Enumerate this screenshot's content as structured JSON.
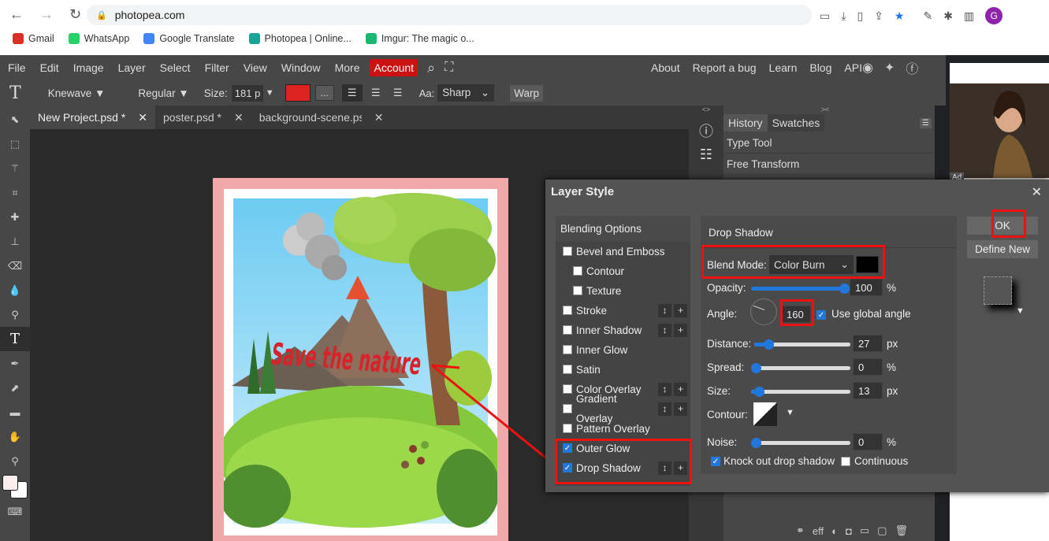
{
  "browser": {
    "url": "photopea.com",
    "profile_initial": "G",
    "bookmarks": [
      {
        "label": "Gmail",
        "color": "#d93025"
      },
      {
        "label": "WhatsApp",
        "color": "#25d366"
      },
      {
        "label": "Google Translate",
        "color": "#4285f4"
      },
      {
        "label": "Photopea | Online...",
        "color": "#18a497"
      },
      {
        "label": "Imgur: The magic o...",
        "color": "#1bb76e"
      }
    ]
  },
  "menu": {
    "items": [
      "File",
      "Edit",
      "Image",
      "Layer",
      "Select",
      "Filter",
      "View",
      "Window",
      "More"
    ],
    "account": "Account",
    "right": [
      "About",
      "Report a bug",
      "Learn",
      "Blog",
      "API"
    ]
  },
  "options": {
    "font": "Knewave",
    "style": "Regular",
    "size_label": "Size:",
    "size": "181 p",
    "more": "...",
    "aa_label": "Aa:",
    "aa": "Sharp",
    "warp": "Warp"
  },
  "tabs": [
    {
      "label": "New Project.psd *"
    },
    {
      "label": "poster.psd *"
    },
    {
      "label": "background-scene.ps"
    }
  ],
  "poster": {
    "text": "Save the nature"
  },
  "history": {
    "tabs": [
      "History",
      "Swatches"
    ],
    "items": [
      "Type Tool",
      "Free Transform"
    ]
  },
  "ad": {
    "badge": "Ad"
  },
  "dialog": {
    "title": "Layer Style",
    "left": {
      "header": "Blending Options",
      "items": [
        {
          "label": "Bevel and Emboss",
          "checked": false,
          "indent": false,
          "btns": false,
          "plus": false
        },
        {
          "label": "Contour",
          "checked": false,
          "indent": true,
          "btns": false,
          "plus": false
        },
        {
          "label": "Texture",
          "checked": false,
          "indent": true,
          "btns": false,
          "plus": false
        },
        {
          "label": "Stroke",
          "checked": false,
          "indent": false,
          "btns": true,
          "plus": true
        },
        {
          "label": "Inner Shadow",
          "checked": false,
          "indent": false,
          "btns": true,
          "plus": true
        },
        {
          "label": "Inner Glow",
          "checked": false,
          "indent": false,
          "btns": false,
          "plus": false
        },
        {
          "label": "Satin",
          "checked": false,
          "indent": false,
          "btns": false,
          "plus": false
        },
        {
          "label": "Color Overlay",
          "checked": false,
          "indent": false,
          "btns": true,
          "plus": true
        },
        {
          "label": "Gradient Overlay",
          "checked": false,
          "indent": false,
          "btns": true,
          "plus": true
        },
        {
          "label": "Pattern Overlay",
          "checked": false,
          "indent": false,
          "btns": false,
          "plus": false
        },
        {
          "label": "Outer Glow",
          "checked": true,
          "indent": false,
          "btns": false,
          "plus": false
        },
        {
          "label": "Drop Shadow",
          "checked": true,
          "indent": false,
          "btns": true,
          "plus": true
        }
      ]
    },
    "section": "Drop Shadow",
    "blend_label": "Blend Mode:",
    "blend_mode": "Color Burn",
    "shadow_color": "#000000",
    "opacity_label": "Opacity:",
    "opacity": "100",
    "opacity_unit": "%",
    "angle_label": "Angle:",
    "angle": "160",
    "global_label": "Use global angle",
    "distance_label": "Distance:",
    "distance": "27",
    "distance_unit": "px",
    "spread_label": "Spread:",
    "spread": "0",
    "spread_unit": "%",
    "size_label": "Size:",
    "size": "13",
    "size_unit": "px",
    "contour_label": "Contour:",
    "noise_label": "Noise:",
    "noise": "0",
    "noise_unit": "%",
    "knockout_label": "Knock out drop shadow",
    "continuous_label": "Continuous",
    "ok": "OK",
    "define_new": "Define New"
  },
  "colors": {
    "accent": "#2277dd",
    "highlight": "#e11111",
    "account": "#cc1111",
    "fg_color": "#dd2222"
  }
}
